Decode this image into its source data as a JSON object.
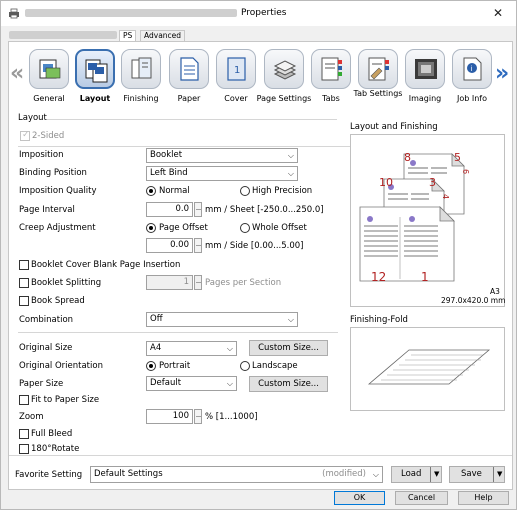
{
  "window": {
    "title": "Properties",
    "close": "✕"
  },
  "printer_tabs": [
    {
      "label": "PS"
    },
    {
      "label": "Advanced"
    }
  ],
  "ribbon": {
    "items": [
      {
        "label": "General",
        "icon": "general-icon"
      },
      {
        "label": "Layout",
        "icon": "layout-icon"
      },
      {
        "label": "Finishing",
        "icon": "finishing-icon"
      },
      {
        "label": "Paper",
        "icon": "paper-icon"
      },
      {
        "label": "Cover",
        "icon": "cover-icon"
      },
      {
        "label": "Page Settings",
        "icon": "page-settings-icon"
      },
      {
        "label": "Tabs",
        "icon": "tabs-icon"
      },
      {
        "label": "Tab Settings",
        "icon": "tab-settings-icon"
      },
      {
        "label": "Imaging",
        "icon": "imaging-icon"
      },
      {
        "label": "Job Info",
        "icon": "job-info-icon"
      }
    ],
    "active": "Layout",
    "prev_arrow": "«",
    "next_arrow": "»"
  },
  "layout": {
    "section_title": "Layout",
    "two_sided": "2-Sided",
    "imposition": {
      "label": "Imposition",
      "value": "Booklet"
    },
    "binding_position": {
      "label": "Binding Position",
      "value": "Left Bind"
    },
    "imposition_quality": {
      "label": "Imposition Quality",
      "normal": "Normal",
      "high": "High Precision"
    },
    "page_interval": {
      "label": "Page Interval",
      "value": "0.0",
      "unit": "mm / Sheet [-250.0...250.0]"
    },
    "creep_adjustment": {
      "label": "Creep Adjustment",
      "page_offset": "Page Offset",
      "whole_offset": "Whole Offset",
      "value": "0.00",
      "unit": "mm / Side [0.00...5.00]"
    },
    "cover_blank": "Booklet Cover Blank Page Insertion",
    "booklet_splitting": {
      "label": "Booklet Splitting",
      "value": "1",
      "unit": "Pages per Section"
    },
    "book_spread": "Book Spread",
    "combination": {
      "label": "Combination",
      "value": "Off"
    }
  },
  "paper": {
    "original_size": {
      "label": "Original Size",
      "value": "A4",
      "button": "Custom Size..."
    },
    "original_orientation": {
      "label": "Original Orientation",
      "portrait": "Portrait",
      "landscape": "Landscape"
    },
    "paper_size": {
      "label": "Paper Size",
      "value": "Default",
      "button": "Custom Size..."
    },
    "fit_to_paper": "Fit to Paper Size",
    "zoom": {
      "label": "Zoom",
      "value": "100",
      "unit": "% [1...1000]"
    },
    "full_bleed": "Full Bleed",
    "rotate": "180°Rotate"
  },
  "preview": {
    "title": "Layout and Finishing",
    "page_numbers": [
      "8",
      "5",
      "6",
      "10",
      "3",
      "4",
      "12",
      "1"
    ],
    "paper": "A3",
    "paper_dims": "297.0x420.0 mm",
    "fold_title": "Finishing-Fold"
  },
  "footer": {
    "favorite_label": "Favorite Setting",
    "favorite_value": "Default Settings",
    "favorite_state": "(modified)",
    "load": "Load",
    "save": "Save",
    "ok": "OK",
    "cancel": "Cancel",
    "help": "Help"
  },
  "colors": {
    "accent": "#0078d7",
    "page_number": "#b22222",
    "active_tab_border": "#3a6fb0"
  }
}
